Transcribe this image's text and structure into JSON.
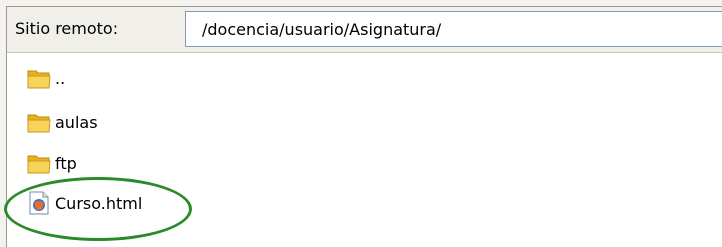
{
  "address_bar": {
    "label": "Sitio remoto:",
    "path": "/docencia/usuario/Asignatura/"
  },
  "files": [
    {
      "name": "..",
      "icon": "folder-icon"
    },
    {
      "name": "aulas",
      "icon": "folder-icon"
    },
    {
      "name": "ftp",
      "icon": "folder-icon"
    },
    {
      "name": "Curso.html",
      "icon": "html-file-icon"
    }
  ],
  "colors": {
    "folder": "#f5c531",
    "highlight_circle": "#2a8a2a",
    "input_border": "#7f9db9"
  }
}
